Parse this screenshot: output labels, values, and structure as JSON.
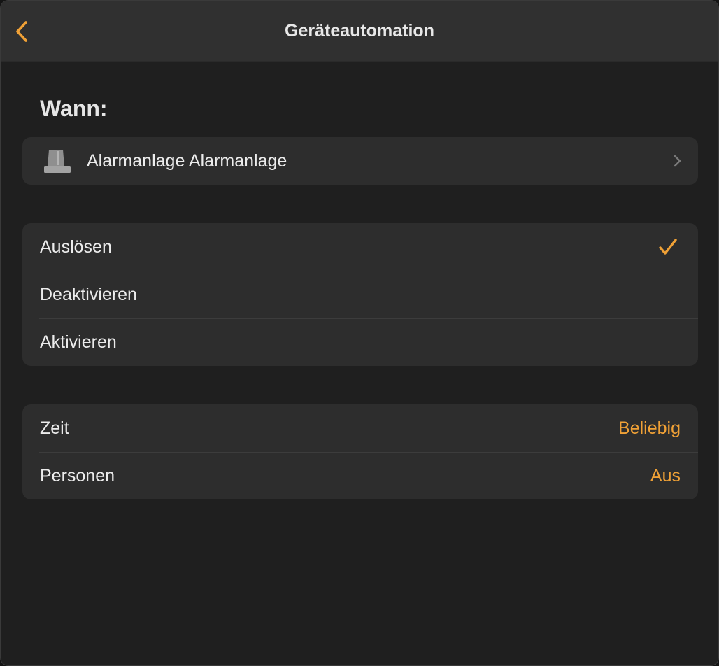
{
  "nav": {
    "title": "Geräteautomation",
    "back_icon": "chevron-left-icon"
  },
  "trigger": {
    "section_label": "Wann:",
    "device": {
      "label": "Alarmanlage Alarmanlage",
      "icon": "security-system-icon"
    }
  },
  "options": {
    "items": [
      {
        "label": "Auslösen",
        "selected": true
      },
      {
        "label": "Deaktivieren",
        "selected": false
      },
      {
        "label": "Aktivieren",
        "selected": false
      }
    ]
  },
  "conditions": {
    "items": [
      {
        "label": "Zeit",
        "value": "Beliebig"
      },
      {
        "label": "Personen",
        "value": "Aus"
      }
    ]
  },
  "colors": {
    "accent": "#f0a136",
    "background": "#1f1f1f",
    "nav_background": "#303030",
    "group_background": "#2d2d2d",
    "text": "#ececec"
  }
}
